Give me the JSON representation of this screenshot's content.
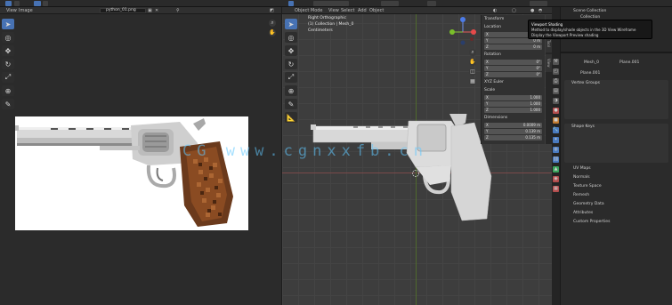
{
  "topbar": {
    "menu_view": "View",
    "menu_image": "Image"
  },
  "image_editor": {
    "filename": "python_01.png",
    "header_view": "View",
    "header_image": "Image",
    "tools": [
      "cursor-icon",
      "sample-icon",
      "move-icon",
      "rotate-icon",
      "scale-icon",
      "transform-icon",
      "annotate-icon"
    ]
  },
  "viewport": {
    "mode": "Object Mode",
    "menu": [
      "View",
      "Select",
      "Add",
      "Object"
    ],
    "info_lines": [
      "Right Orthographic",
      "(1) Collection | Mesh_0",
      "Centimeters"
    ],
    "transform_title": "Transform",
    "location_label": "Location",
    "location": [
      {
        "axis": "X",
        "value": "0 m"
      },
      {
        "axis": "Y",
        "value": "0 m"
      },
      {
        "axis": "Z",
        "value": "0 m"
      }
    ],
    "rotation_label": "Rotation",
    "rotation": [
      {
        "axis": "X",
        "value": "0°"
      },
      {
        "axis": "Y",
        "value": "0°"
      },
      {
        "axis": "Z",
        "value": "0°"
      }
    ],
    "rotation_mode": "XYZ Euler",
    "scale_label": "Scale",
    "scale": [
      {
        "axis": "X",
        "value": "1.000"
      },
      {
        "axis": "Y",
        "value": "1.000"
      },
      {
        "axis": "Z",
        "value": "1.000"
      }
    ],
    "dimensions_label": "Dimensions",
    "dimensions": [
      {
        "axis": "X",
        "value": "0.0009 m"
      },
      {
        "axis": "Y",
        "value": "0.139 m"
      },
      {
        "axis": "Z",
        "value": "0.135 m"
      }
    ],
    "side_tabs": [
      "Item",
      "Tool",
      "View"
    ]
  },
  "tooltip": {
    "title": "Viewport Shading",
    "line1": "Method to display/shade objects in the 3D View Wireframe",
    "line2": "Display the Viewport Preview shading"
  },
  "properties": {
    "outliner_title": "Scene Collection",
    "outliner_item": "Collection",
    "object_name": "Mesh_0",
    "mesh_name": "Plane.001",
    "data_name": "Plane.001",
    "sections_open": [
      "Vertex Groups",
      "Shape Keys"
    ],
    "sections_closed": [
      "UV Maps",
      "Normals",
      "Texture Space",
      "Remesh",
      "Geometry Data",
      "Attributes",
      "Custom Properties"
    ]
  },
  "watermark": "CG www.cgnxxfb.cn"
}
